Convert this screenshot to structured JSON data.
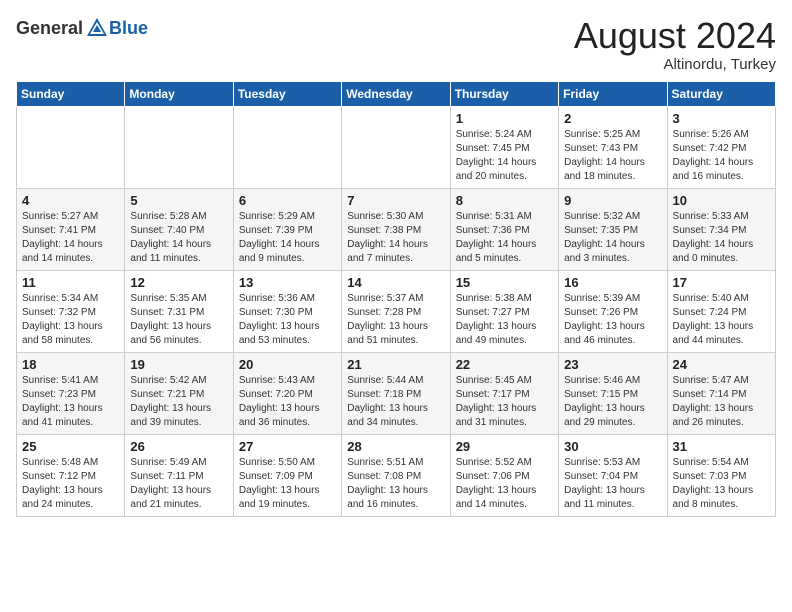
{
  "header": {
    "logo_general": "General",
    "logo_blue": "Blue",
    "month_year": "August 2024",
    "location": "Altinordu, Turkey"
  },
  "weekdays": [
    "Sunday",
    "Monday",
    "Tuesday",
    "Wednesday",
    "Thursday",
    "Friday",
    "Saturday"
  ],
  "weeks": [
    [
      {
        "day": "",
        "text": ""
      },
      {
        "day": "",
        "text": ""
      },
      {
        "day": "",
        "text": ""
      },
      {
        "day": "",
        "text": ""
      },
      {
        "day": "1",
        "text": "Sunrise: 5:24 AM\nSunset: 7:45 PM\nDaylight: 14 hours and 20 minutes."
      },
      {
        "day": "2",
        "text": "Sunrise: 5:25 AM\nSunset: 7:43 PM\nDaylight: 14 hours and 18 minutes."
      },
      {
        "day": "3",
        "text": "Sunrise: 5:26 AM\nSunset: 7:42 PM\nDaylight: 14 hours and 16 minutes."
      }
    ],
    [
      {
        "day": "4",
        "text": "Sunrise: 5:27 AM\nSunset: 7:41 PM\nDaylight: 14 hours and 14 minutes."
      },
      {
        "day": "5",
        "text": "Sunrise: 5:28 AM\nSunset: 7:40 PM\nDaylight: 14 hours and 11 minutes."
      },
      {
        "day": "6",
        "text": "Sunrise: 5:29 AM\nSunset: 7:39 PM\nDaylight: 14 hours and 9 minutes."
      },
      {
        "day": "7",
        "text": "Sunrise: 5:30 AM\nSunset: 7:38 PM\nDaylight: 14 hours and 7 minutes."
      },
      {
        "day": "8",
        "text": "Sunrise: 5:31 AM\nSunset: 7:36 PM\nDaylight: 14 hours and 5 minutes."
      },
      {
        "day": "9",
        "text": "Sunrise: 5:32 AM\nSunset: 7:35 PM\nDaylight: 14 hours and 3 minutes."
      },
      {
        "day": "10",
        "text": "Sunrise: 5:33 AM\nSunset: 7:34 PM\nDaylight: 14 hours and 0 minutes."
      }
    ],
    [
      {
        "day": "11",
        "text": "Sunrise: 5:34 AM\nSunset: 7:32 PM\nDaylight: 13 hours and 58 minutes."
      },
      {
        "day": "12",
        "text": "Sunrise: 5:35 AM\nSunset: 7:31 PM\nDaylight: 13 hours and 56 minutes."
      },
      {
        "day": "13",
        "text": "Sunrise: 5:36 AM\nSunset: 7:30 PM\nDaylight: 13 hours and 53 minutes."
      },
      {
        "day": "14",
        "text": "Sunrise: 5:37 AM\nSunset: 7:28 PM\nDaylight: 13 hours and 51 minutes."
      },
      {
        "day": "15",
        "text": "Sunrise: 5:38 AM\nSunset: 7:27 PM\nDaylight: 13 hours and 49 minutes."
      },
      {
        "day": "16",
        "text": "Sunrise: 5:39 AM\nSunset: 7:26 PM\nDaylight: 13 hours and 46 minutes."
      },
      {
        "day": "17",
        "text": "Sunrise: 5:40 AM\nSunset: 7:24 PM\nDaylight: 13 hours and 44 minutes."
      }
    ],
    [
      {
        "day": "18",
        "text": "Sunrise: 5:41 AM\nSunset: 7:23 PM\nDaylight: 13 hours and 41 minutes."
      },
      {
        "day": "19",
        "text": "Sunrise: 5:42 AM\nSunset: 7:21 PM\nDaylight: 13 hours and 39 minutes."
      },
      {
        "day": "20",
        "text": "Sunrise: 5:43 AM\nSunset: 7:20 PM\nDaylight: 13 hours and 36 minutes."
      },
      {
        "day": "21",
        "text": "Sunrise: 5:44 AM\nSunset: 7:18 PM\nDaylight: 13 hours and 34 minutes."
      },
      {
        "day": "22",
        "text": "Sunrise: 5:45 AM\nSunset: 7:17 PM\nDaylight: 13 hours and 31 minutes."
      },
      {
        "day": "23",
        "text": "Sunrise: 5:46 AM\nSunset: 7:15 PM\nDaylight: 13 hours and 29 minutes."
      },
      {
        "day": "24",
        "text": "Sunrise: 5:47 AM\nSunset: 7:14 PM\nDaylight: 13 hours and 26 minutes."
      }
    ],
    [
      {
        "day": "25",
        "text": "Sunrise: 5:48 AM\nSunset: 7:12 PM\nDaylight: 13 hours and 24 minutes."
      },
      {
        "day": "26",
        "text": "Sunrise: 5:49 AM\nSunset: 7:11 PM\nDaylight: 13 hours and 21 minutes."
      },
      {
        "day": "27",
        "text": "Sunrise: 5:50 AM\nSunset: 7:09 PM\nDaylight: 13 hours and 19 minutes."
      },
      {
        "day": "28",
        "text": "Sunrise: 5:51 AM\nSunset: 7:08 PM\nDaylight: 13 hours and 16 minutes."
      },
      {
        "day": "29",
        "text": "Sunrise: 5:52 AM\nSunset: 7:06 PM\nDaylight: 13 hours and 14 minutes."
      },
      {
        "day": "30",
        "text": "Sunrise: 5:53 AM\nSunset: 7:04 PM\nDaylight: 13 hours and 11 minutes."
      },
      {
        "day": "31",
        "text": "Sunrise: 5:54 AM\nSunset: 7:03 PM\nDaylight: 13 hours and 8 minutes."
      }
    ]
  ]
}
